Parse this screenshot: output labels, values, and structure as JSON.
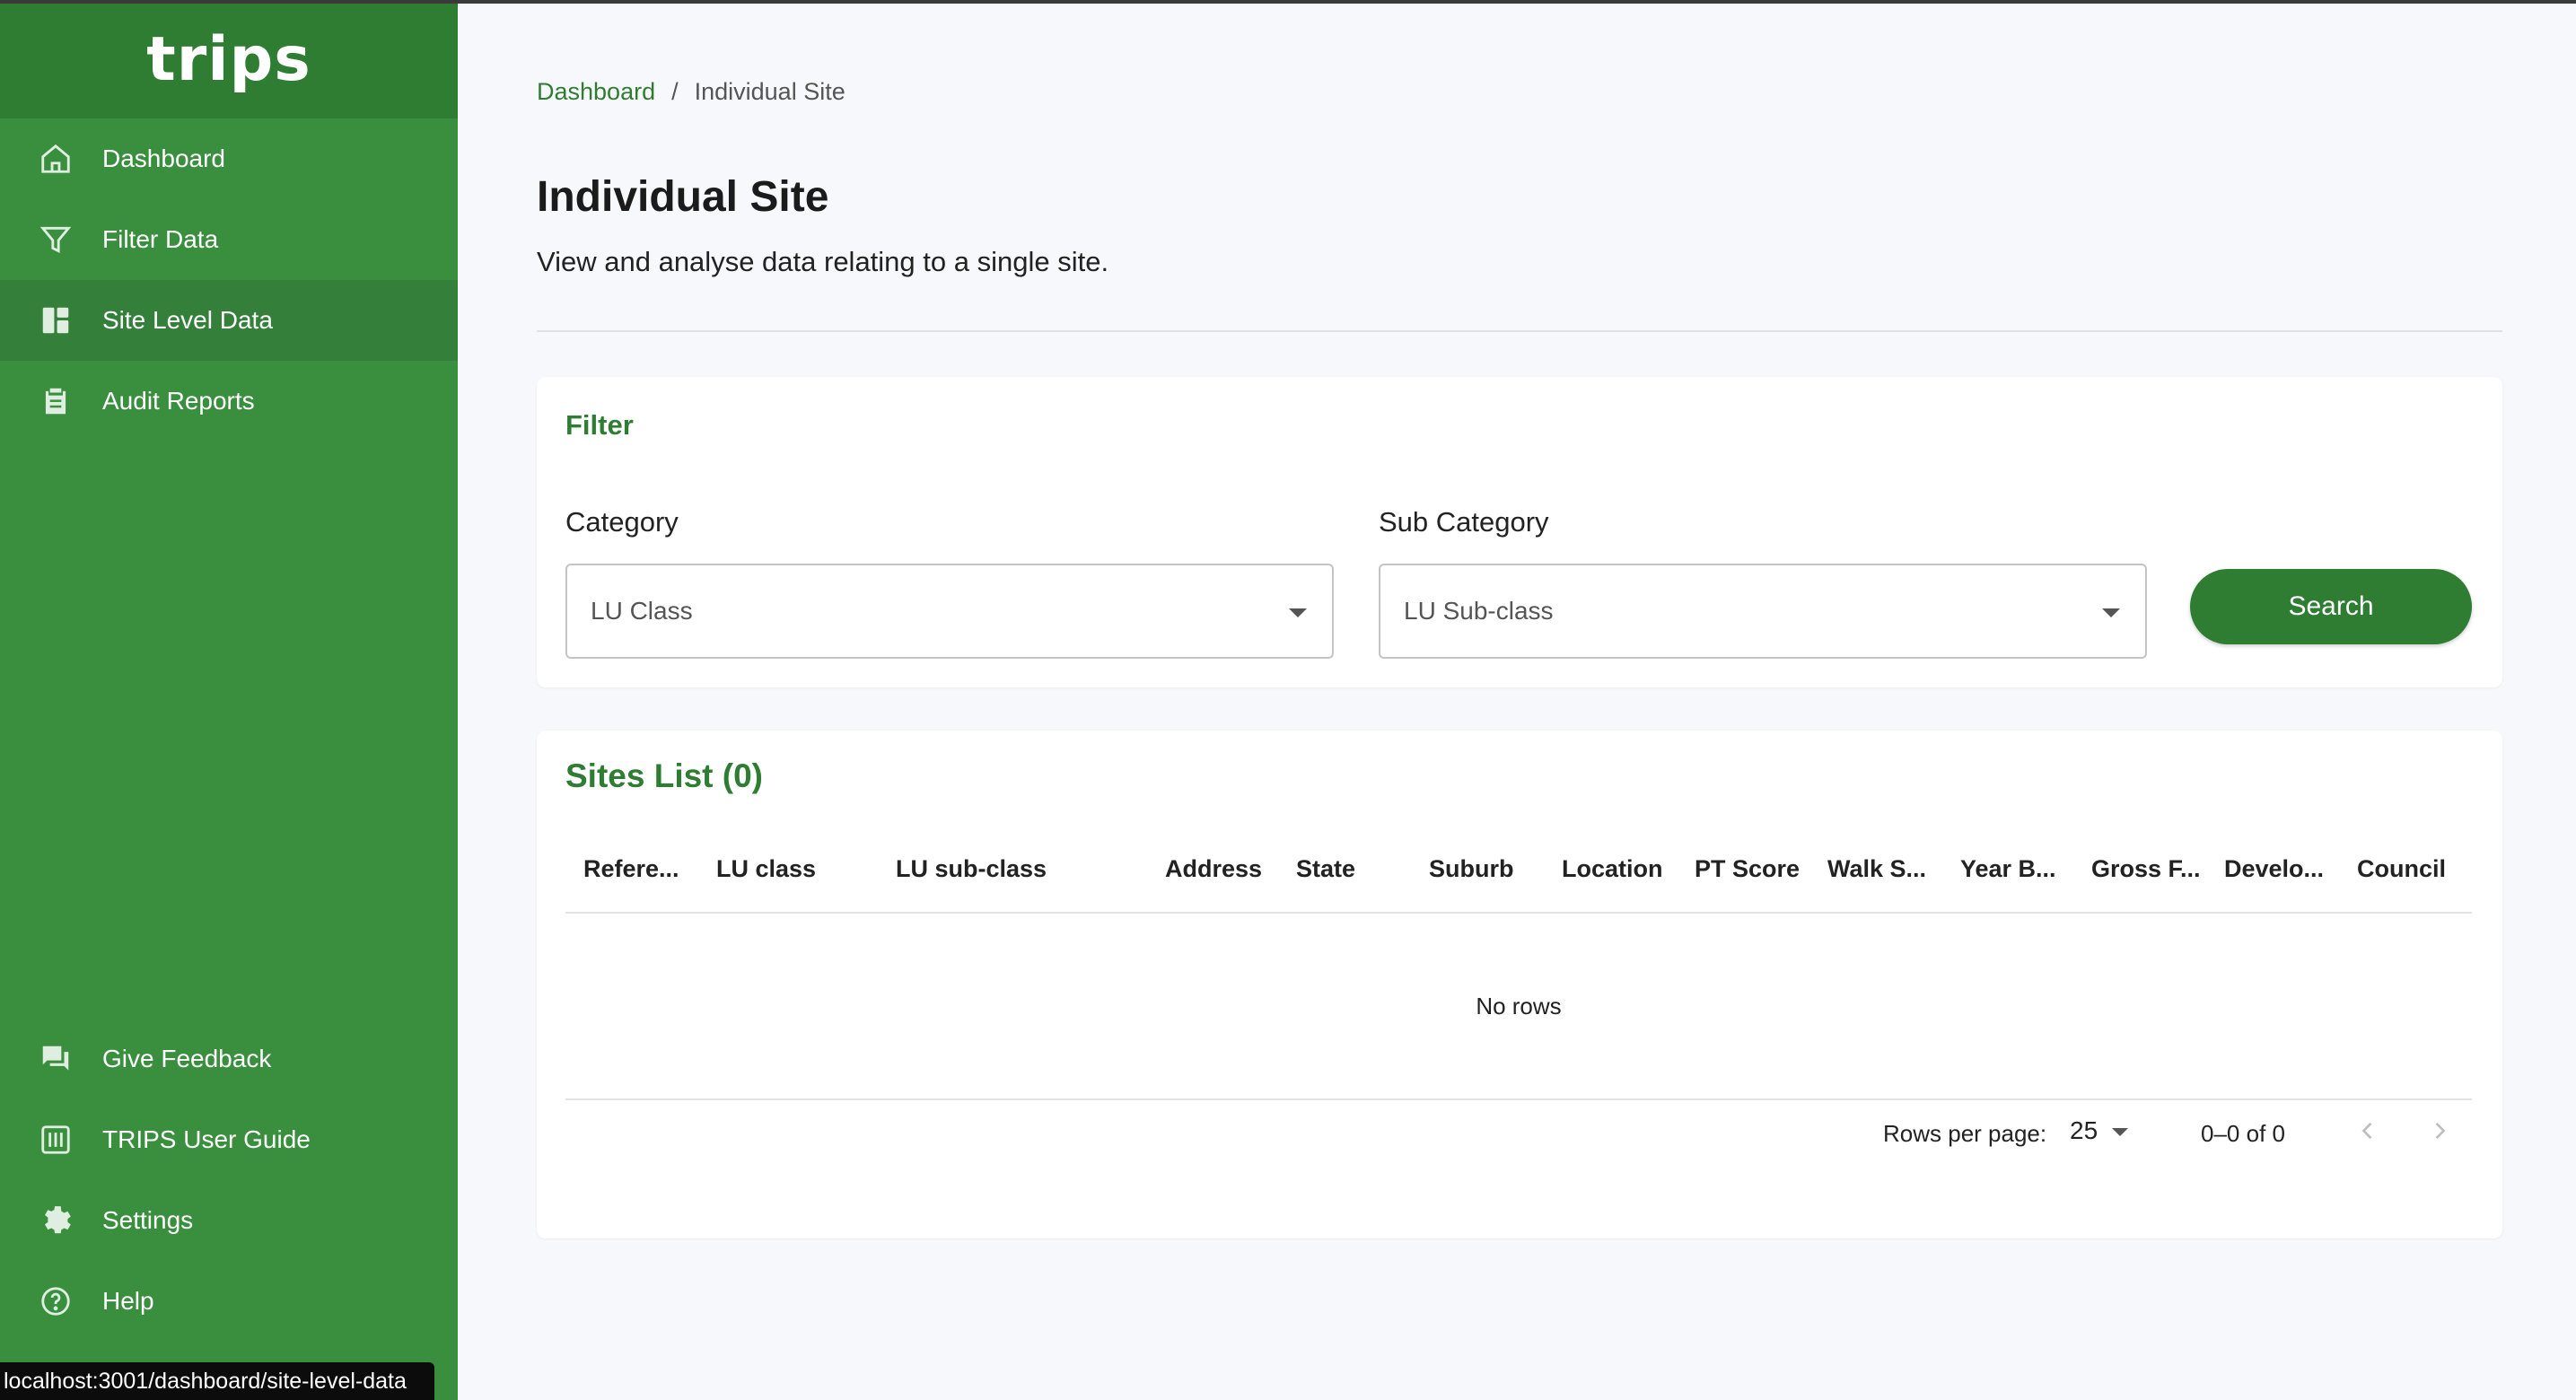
{
  "app": {
    "logo_text": "trips"
  },
  "sidebar": {
    "items": [
      {
        "label": "Dashboard",
        "icon": "home-icon"
      },
      {
        "label": "Filter Data",
        "icon": "filter-icon"
      },
      {
        "label": "Site Level Data",
        "icon": "dashboard-grid-icon",
        "active": true
      },
      {
        "label": "Audit Reports",
        "icon": "clipboard-icon"
      }
    ],
    "bottom_items": [
      {
        "label": "Give Feedback",
        "icon": "feedback-icon"
      },
      {
        "label": "TRIPS User Guide",
        "icon": "guide-icon"
      },
      {
        "label": "Settings",
        "icon": "gear-icon"
      },
      {
        "label": "Help",
        "icon": "help-icon"
      }
    ]
  },
  "breadcrumb": {
    "link": "Dashboard",
    "separator": "/",
    "current": "Individual Site"
  },
  "page": {
    "title": "Individual Site",
    "subtitle": "View and analyse data relating to a single site."
  },
  "filter": {
    "title": "Filter",
    "category_label": "Category",
    "category_value": "LU Class",
    "subcategory_label": "Sub Category",
    "subcategory_value": "LU Sub-class",
    "search_label": "Search"
  },
  "sites_list": {
    "title": "Sites List (0)",
    "columns": [
      "Refere...",
      "LU class",
      "LU sub-class",
      "Address",
      "State",
      "Suburb",
      "Location",
      "PT Score",
      "Walk S...",
      "Year B...",
      "Gross F...",
      "Develo...",
      "Council"
    ],
    "empty_text": "No rows",
    "rows_per_page_label": "Rows per page:",
    "rows_per_page": "25",
    "range_text": "0–0 of 0"
  },
  "status_bar": {
    "url": "localhost:3001/dashboard/site-level-data"
  },
  "colors": {
    "sidebar": "#3a8f3f",
    "brand": "#2e7d32",
    "accent": "#2e7d32"
  }
}
